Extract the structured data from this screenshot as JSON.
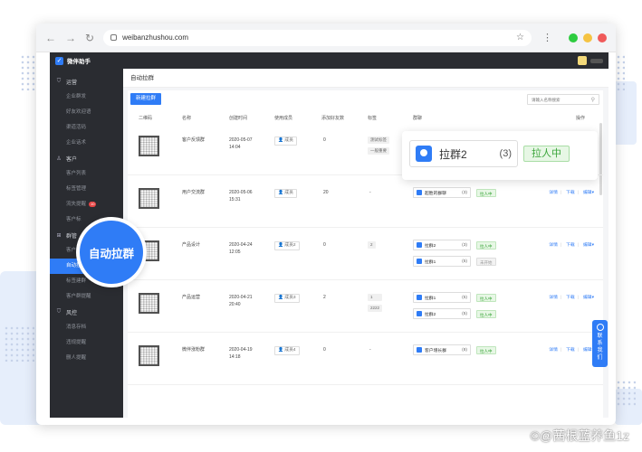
{
  "browser": {
    "url": "weibanzhushou.com",
    "back": "←",
    "forward": "→",
    "reload": "↻",
    "star": "☆",
    "menu": "⋮",
    "traffic_colors": [
      "#2ecc40",
      "#f5c342",
      "#f05a5a"
    ]
  },
  "app": {
    "name": "微伴助手",
    "logo_glyph": "✓",
    "page_title": "自动拉群",
    "new_button": "新建拉群",
    "search_placeholder": "请输入名称搜索",
    "search_icon": "⚲"
  },
  "sidebar": [
    {
      "type": "group",
      "icon": "⛉",
      "label": "运营"
    },
    {
      "type": "item",
      "label": "企业群发"
    },
    {
      "type": "item",
      "label": "好友欢迎语"
    },
    {
      "type": "item",
      "label": "渠道活码"
    },
    {
      "type": "item",
      "label": "企业话术"
    },
    {
      "type": "group",
      "icon": "♙",
      "label": "客户"
    },
    {
      "type": "item",
      "label": "客户列表"
    },
    {
      "type": "item",
      "label": "标签管理"
    },
    {
      "type": "item",
      "label": "流失提醒",
      "badge": "10"
    },
    {
      "type": "item",
      "label": "客户标"
    },
    {
      "type": "group",
      "icon": "⊞",
      "label": "群管"
    },
    {
      "type": "item",
      "label": "客户"
    },
    {
      "type": "item",
      "label": "自动拉群",
      "active": true
    },
    {
      "type": "item",
      "label": "标签建群"
    },
    {
      "type": "item",
      "label": "客户群提醒"
    },
    {
      "type": "group",
      "icon": "⛉",
      "label": "风控"
    },
    {
      "type": "item",
      "label": "消息存档"
    },
    {
      "type": "item",
      "label": "违规提醒"
    },
    {
      "type": "item",
      "label": "删人提醒"
    }
  ],
  "table": {
    "headers": [
      "二维码",
      "名称",
      "创建时间",
      "使用成员",
      "添加好友数",
      "标签",
      "群聊",
      "操作"
    ],
    "rows": [
      {
        "name": "客户反馈群",
        "date": "2020-05-07",
        "time": "14:04",
        "member": "成员",
        "friends": "0",
        "tags": [
          "测试标签",
          "一般重要"
        ],
        "groups": [],
        "ops": [
          "编辑▾"
        ]
      },
      {
        "name": "用户交流群",
        "date": "2020-05-06",
        "time": "15:31",
        "member": "成员",
        "friends": "20",
        "tags_text": "-",
        "groups": [
          {
            "name": "超胜的群聊",
            "count": "(3)",
            "status": "拉人中",
            "on": true
          }
        ],
        "ops": [
          "详情",
          "下载",
          "编辑▾"
        ]
      },
      {
        "name": "产品设计",
        "date": "2020-04-24",
        "time": "12:05",
        "member": "成员2",
        "friends": "0",
        "tags": [
          "2"
        ],
        "groups": [
          {
            "name": "拉群2",
            "count": "(3)",
            "status": "拉人中",
            "on": true
          },
          {
            "name": "拉群1",
            "count": "(5)",
            "status": "未开始",
            "on": false
          }
        ],
        "ops": [
          "详情",
          "下载",
          "编辑▾"
        ]
      },
      {
        "name": "产品运营",
        "date": "2020-04-21",
        "time": "20:40",
        "member": "成员3",
        "friends": "2",
        "tags": [
          "1",
          "2222"
        ],
        "groups": [
          {
            "name": "拉群1",
            "count": "(5)",
            "status": "拉人中",
            "on": true
          },
          {
            "name": "拉群2",
            "count": "(5)",
            "status": "拉人中",
            "on": true
          }
        ],
        "ops": [
          "详情",
          "下载",
          "编辑▾"
        ]
      },
      {
        "name": "微伴涨粉群",
        "date": "2020-04-19",
        "time": "14:18",
        "member": "成员4",
        "friends": "0",
        "tags_text": "-",
        "groups": [
          {
            "name": "客户增长群",
            "count": "(8)",
            "status": "拉人中",
            "on": true
          }
        ],
        "ops": [
          "详情",
          "下载",
          "编辑▾"
        ]
      }
    ]
  },
  "popup": {
    "name": "拉群2",
    "count": "(3)",
    "status": "拉人中"
  },
  "magnifier": {
    "label": "自动拉群"
  },
  "contact": {
    "label": "联系我们"
  },
  "watermark": "©@茜根蓝养鱼1z",
  "colors": {
    "accent": "#2f7cf6",
    "sidebar": "#2a2c31",
    "success": "#3aa53a"
  }
}
